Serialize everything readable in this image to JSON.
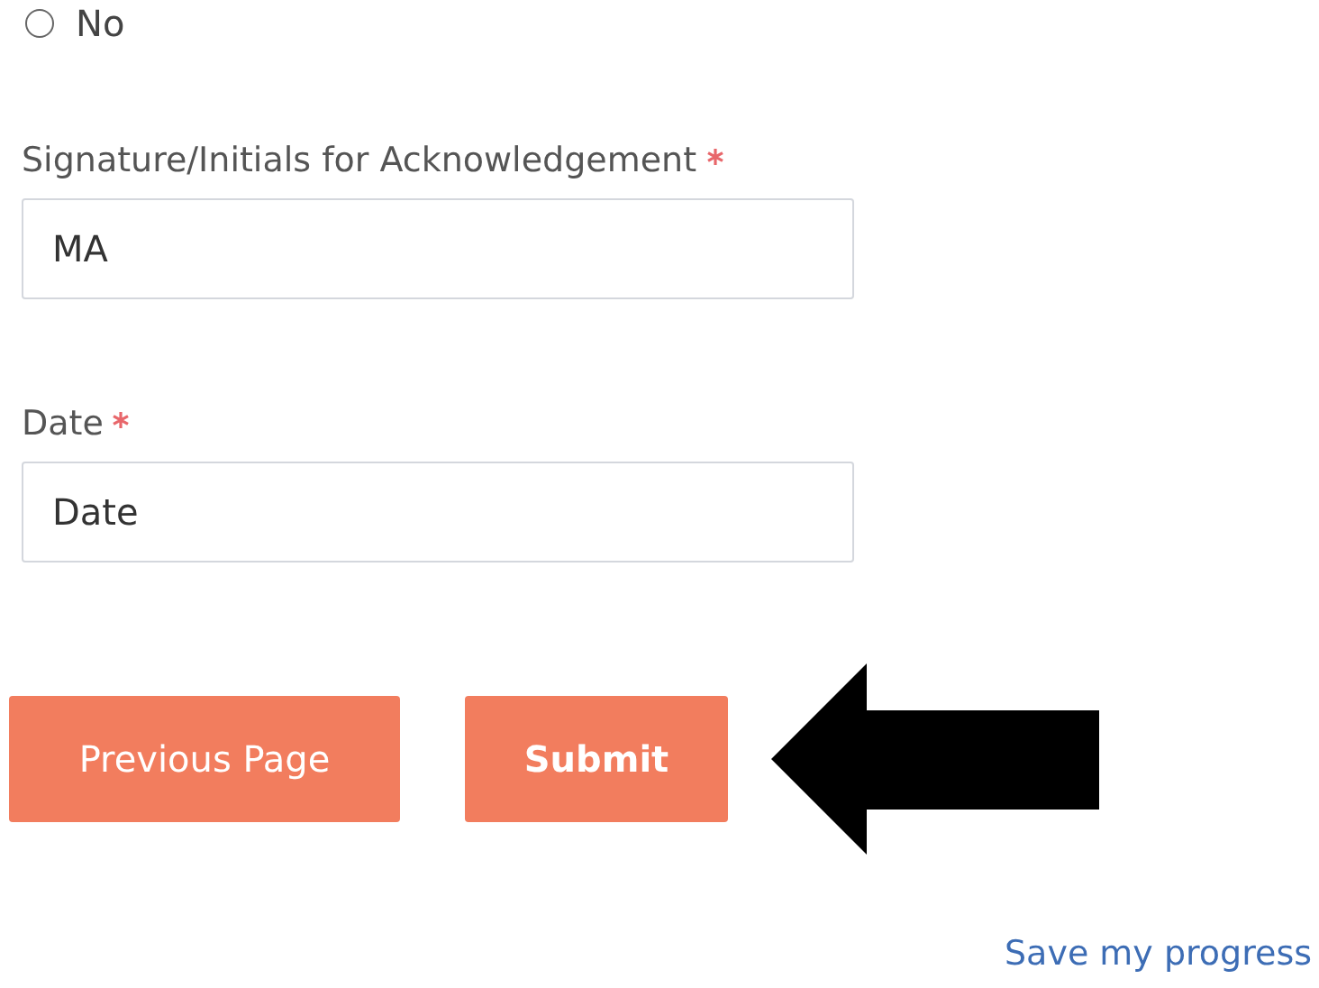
{
  "radio_option": {
    "label": "No",
    "selected": false
  },
  "fields": [
    {
      "label": "Signature/Initials for Acknowledgement",
      "required": true,
      "value": "MA"
    },
    {
      "label": "Date",
      "required": true,
      "value": "Date"
    }
  ],
  "buttons": [
    {
      "label": "Previous Page",
      "kind": "secondary"
    },
    {
      "label": "Submit",
      "kind": "primary"
    }
  ],
  "save_link": "Save my progress"
}
